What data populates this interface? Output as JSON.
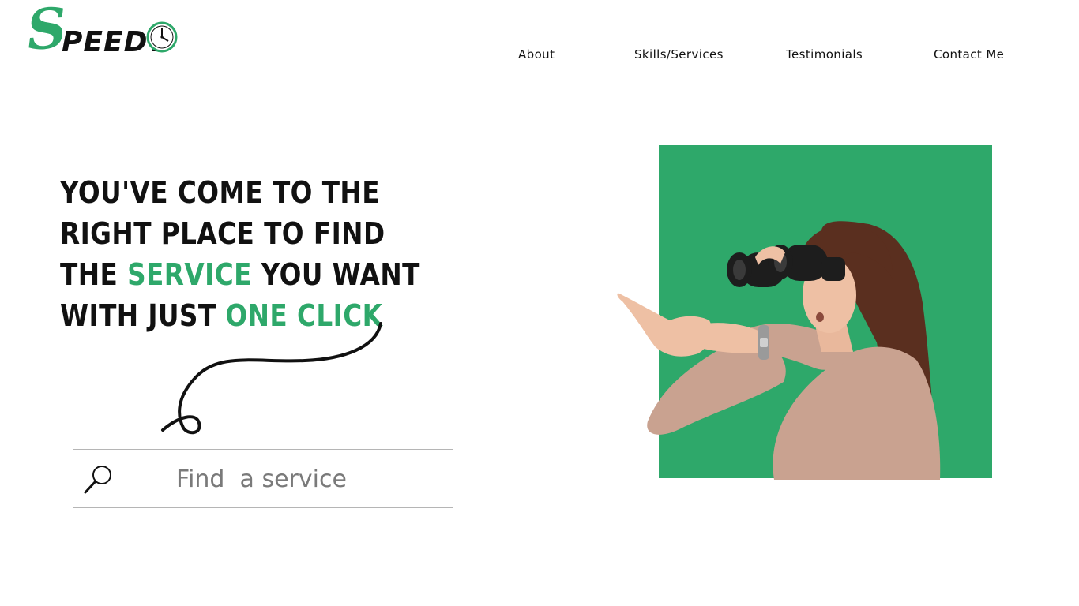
{
  "brand": {
    "initial": "S",
    "rest": "PEEDY",
    "accent_color": "#2ea86a",
    "clock_icon": "clock-icon"
  },
  "nav": {
    "items": [
      {
        "label": "About"
      },
      {
        "label": "Skills/Services"
      },
      {
        "label": "Testimonials"
      },
      {
        "label": "Contact Me"
      }
    ]
  },
  "hero": {
    "headline_part1": "You've come to the right place to find the ",
    "headline_accent1": "service",
    "headline_part2": " you want with just ",
    "headline_accent2": "one click",
    "image_icon": "woman-with-binoculars-image",
    "image_bg_color": "#2ea86a"
  },
  "search": {
    "placeholder": "Find  a service",
    "icon": "search-icon"
  }
}
